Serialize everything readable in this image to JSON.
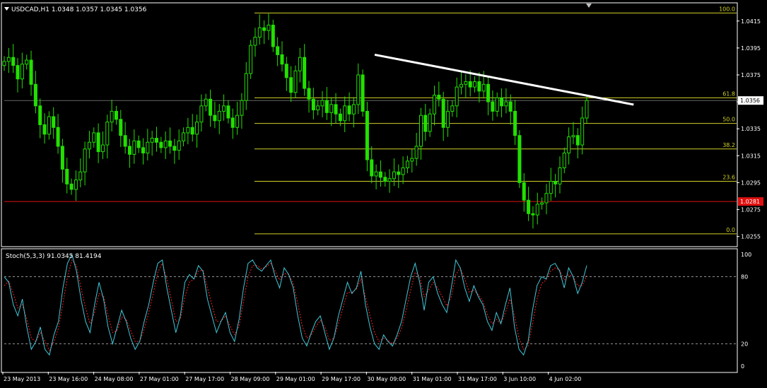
{
  "chart_data": {
    "type": "line",
    "main_chart": {
      "title": "USDCAD,H1  1.0348 1.0357 1.0345 1.0356",
      "ylim": [
        1.0248,
        1.0428
      ],
      "y_ticks": [
        "1.0415",
        "1.0395",
        "1.0375",
        "1.0355",
        "1.0335",
        "1.0315",
        "1.0295",
        "1.0275",
        "1.0255"
      ],
      "current_price_label": "1.0356",
      "current_price": 1.0356,
      "horizontal_line_label": "1.0281",
      "horizontal_line_price": 1.0281,
      "fibonacci_levels": [
        {
          "label": "100.0",
          "price": 1.0421
        },
        {
          "label": "61.8",
          "price": 1.0358
        },
        {
          "label": "50.0",
          "price": 1.0339
        },
        {
          "label": "38.2",
          "price": 1.032
        },
        {
          "label": "23.6",
          "price": 1.0296
        },
        {
          "label": "0.0",
          "price": 1.0257
        }
      ],
      "trendline": {
        "from": [
          0.39,
          1.039
        ],
        "to": [
          0.676,
          1.0354
        ]
      },
      "series": [
        {
          "values": [
            1.0385,
            1.0388,
            1.0382,
            1.0372,
            1.0383,
            1.0386,
            1.0368,
            1.0352,
            1.0338,
            1.0331,
            1.0344,
            1.0336,
            1.0322,
            1.0305,
            1.0294,
            1.029,
            1.0297,
            1.0303,
            1.032,
            1.0325,
            1.0332,
            1.0318,
            1.0323,
            1.034,
            1.0348,
            1.0342,
            1.033,
            1.0322,
            1.0316,
            1.0326,
            1.0321,
            1.0317,
            1.0325,
            1.0328,
            1.0325,
            1.0321,
            1.0326,
            1.0322,
            1.0319,
            1.0326,
            1.0332,
            1.0336,
            1.0331,
            1.034,
            1.0352,
            1.0357,
            1.0345,
            1.0341,
            1.0348,
            1.0352,
            1.0343,
            1.0336,
            1.0345,
            1.0356,
            1.0376,
            1.0397,
            1.0403,
            1.041,
            1.0408,
            1.0412,
            1.0396,
            1.039,
            1.0383,
            1.0373,
            1.0362,
            1.0378,
            1.0388,
            1.0365,
            1.0357,
            1.0349,
            1.0352,
            1.0356,
            1.0347,
            1.0353,
            1.0346,
            1.0341,
            1.0352,
            1.0346,
            1.0353,
            1.0375,
            1.0348,
            1.0312,
            1.03,
            1.0303,
            1.0299,
            1.0296,
            1.0298,
            1.0303,
            1.0301,
            1.0306,
            1.0311,
            1.0313,
            1.0322,
            1.0345,
            1.0333,
            1.0346,
            1.036,
            1.0357,
            1.0336,
            1.0348,
            1.0352,
            1.0366,
            1.0368,
            1.037,
            1.0366,
            1.037,
            1.0363,
            1.0368,
            1.0355,
            1.0348,
            1.0358,
            1.0352,
            1.0355,
            1.0348,
            1.033,
            1.0295,
            1.0282,
            1.0272,
            1.0271,
            1.0279,
            1.028,
            1.0287,
            1.0296,
            1.0294,
            1.0306,
            1.0317,
            1.0329,
            1.033,
            1.0323,
            1.0343,
            1.0356
          ]
        }
      ]
    },
    "stochastic": {
      "title": "Stoch(5,3,3) 91.0345 81.4194",
      "ylim": [
        0,
        100
      ],
      "y_ticks": [
        "100",
        "80",
        "20",
        "0"
      ],
      "dashed_levels": [
        80,
        20
      ],
      "series": [
        {
          "values": [
            80,
            75,
            55,
            45,
            60,
            35,
            15,
            22,
            35,
            15,
            10,
            28,
            40,
            70,
            92,
            100,
            85,
            60,
            40,
            30,
            55,
            75,
            60,
            35,
            20,
            35,
            50,
            40,
            25,
            15,
            22,
            40,
            55,
            75,
            92,
            95,
            70,
            50,
            30,
            45,
            75,
            82,
            78,
            90,
            85,
            60,
            45,
            30,
            40,
            48,
            30,
            22,
            42,
            70,
            92,
            95,
            88,
            85,
            90,
            95,
            80,
            70,
            88,
            82,
            70,
            45,
            25,
            18,
            30,
            40,
            45,
            30,
            15,
            25,
            45,
            60,
            75,
            65,
            70,
            85,
            55,
            35,
            20,
            15,
            28,
            22,
            18,
            28,
            40,
            60,
            80,
            92,
            75,
            50,
            75,
            80,
            65,
            55,
            48,
            70,
            95,
            88,
            70,
            58,
            72,
            62,
            55,
            40,
            32,
            48,
            38,
            55,
            70,
            35,
            15,
            10,
            22,
            50,
            72,
            80,
            78,
            90,
            92,
            85,
            70,
            88,
            80,
            65,
            75,
            90
          ]
        },
        {
          "values": [
            72,
            76,
            65,
            52,
            55,
            42,
            25,
            22,
            30,
            22,
            14,
            22,
            34,
            56,
            80,
            95,
            90,
            70,
            52,
            38,
            48,
            65,
            63,
            45,
            30,
            32,
            44,
            42,
            32,
            22,
            22,
            33,
            48,
            65,
            84,
            92,
            78,
            60,
            40,
            42,
            62,
            75,
            78,
            85,
            86,
            70,
            55,
            40,
            40,
            45,
            36,
            28,
            36,
            58,
            80,
            90,
            90,
            87,
            89,
            92,
            85,
            77,
            83,
            82,
            74,
            56,
            36,
            25,
            28,
            35,
            41,
            35,
            23,
            25,
            38,
            52,
            66,
            66,
            69,
            78,
            62,
            45,
            30,
            22,
            25,
            23,
            20,
            25,
            34,
            50,
            68,
            84,
            80,
            62,
            68,
            75,
            70,
            62,
            54,
            62,
            82,
            88,
            78,
            66,
            68,
            64,
            58,
            46,
            38,
            42,
            38,
            48,
            60,
            45,
            25,
            15,
            18,
            38,
            60,
            74,
            77,
            85,
            88,
            86,
            77,
            82,
            80,
            72,
            72,
            81
          ]
        }
      ]
    },
    "x_ticks": [
      "23 May 2013",
      "23 May 16:00",
      "24 May 08:00",
      "27 May 01:00",
      "27 May 17:00",
      "28 May 09:00",
      "29 May 01:00",
      "29 May 17:00",
      "30 May 09:00",
      "31 May 01:00",
      "31 May 17:00",
      "3 Jun 10:00",
      "4 Jun 02:00"
    ],
    "colors": {
      "background": "#000000",
      "candles": "#22e000",
      "stoch_main": "#3fc8d8",
      "stoch_signal": "#ff2020",
      "fib": "#d0d028",
      "trendline": "#ffffff",
      "hline": "#e01010",
      "price_line": "#a0a0a0",
      "grid": "#ffffff"
    }
  }
}
